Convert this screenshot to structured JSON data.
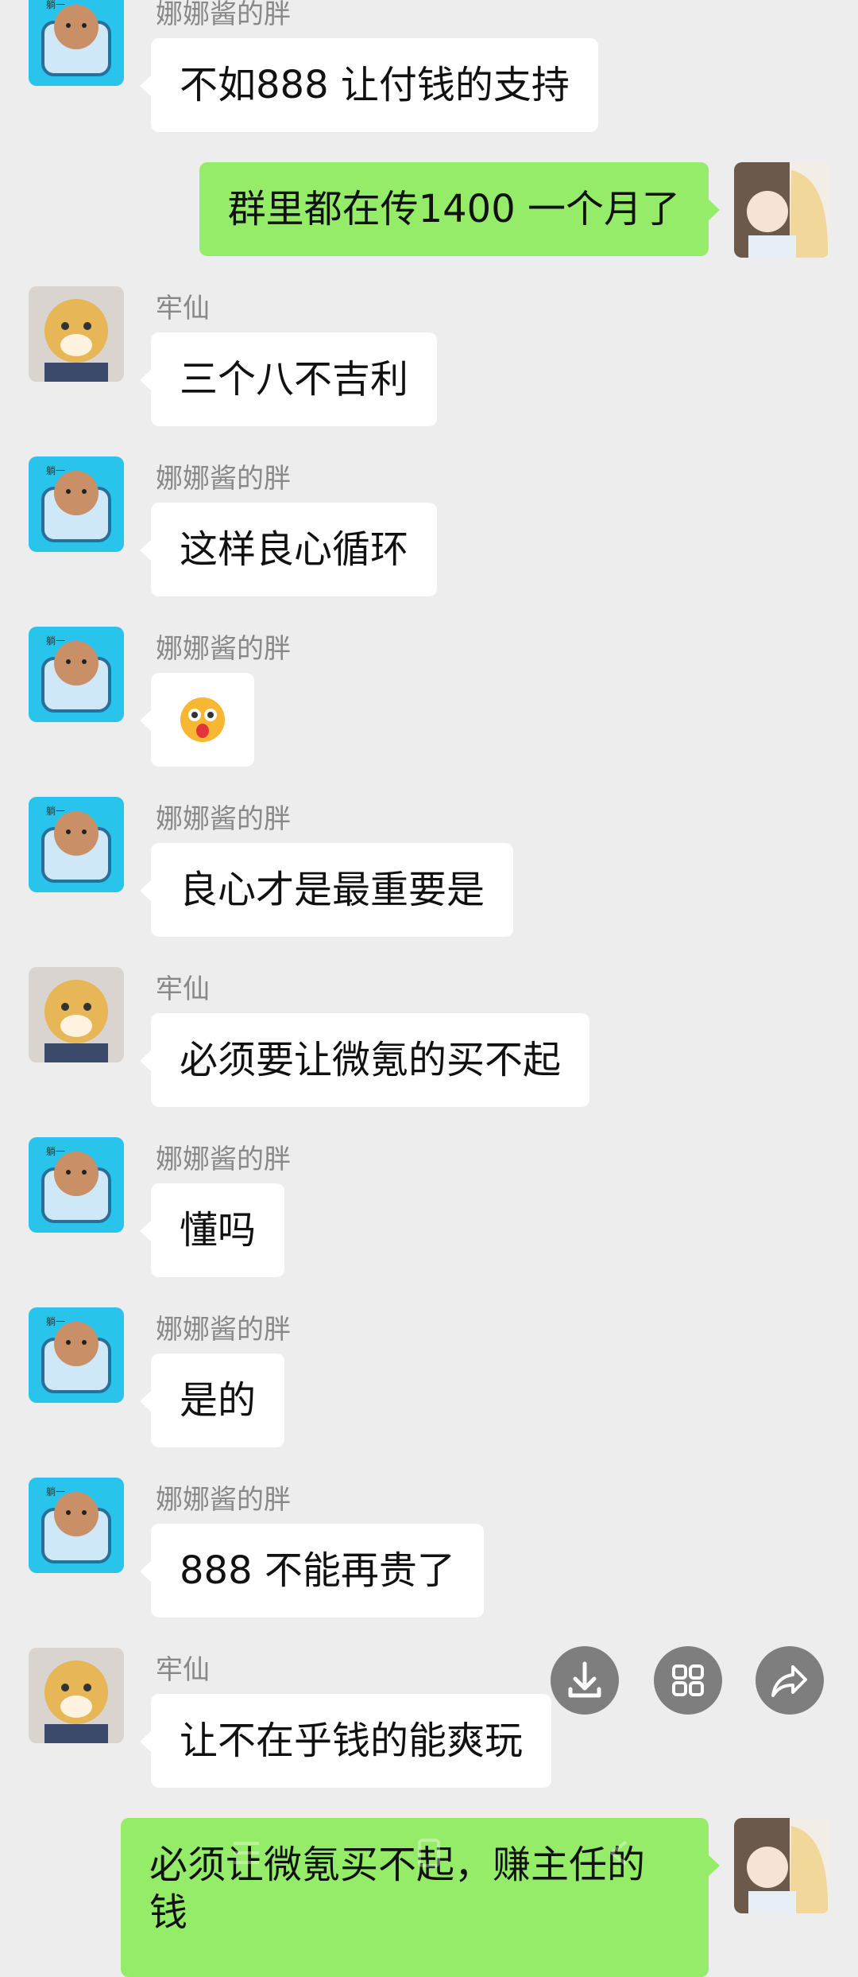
{
  "colors": {
    "background": "#ededed",
    "bubble_self": "#95ec69",
    "bubble_other": "#ffffff",
    "name_text": "#888888"
  },
  "messages": [
    {
      "sender": "娜娜酱的胖",
      "text": "不如888 让付钱的支持",
      "side": "left",
      "avatar": "bear-sofa-avatar"
    },
    {
      "sender": "",
      "text": "群里都在传1400 一个月了",
      "side": "right",
      "avatar": "anime-girl-avatar"
    },
    {
      "sender": "牢仙",
      "text": "三个八不吉利",
      "side": "left",
      "avatar": "cheetah-officer-avatar"
    },
    {
      "sender": "娜娜酱的胖",
      "text": "这样良心循环",
      "side": "left",
      "avatar": "bear-sofa-avatar"
    },
    {
      "sender": "娜娜酱的胖",
      "text": "",
      "emoji": "starry-eyed-tongue-emoji",
      "side": "left",
      "avatar": "bear-sofa-avatar"
    },
    {
      "sender": "娜娜酱的胖",
      "text": "良心才是最重要是",
      "side": "left",
      "avatar": "bear-sofa-avatar"
    },
    {
      "sender": "牢仙",
      "text": "必须要让微氪的买不起",
      "side": "left",
      "avatar": "cheetah-officer-avatar"
    },
    {
      "sender": "娜娜酱的胖",
      "text": "懂吗",
      "side": "left",
      "avatar": "bear-sofa-avatar"
    },
    {
      "sender": "娜娜酱的胖",
      "text": "是的",
      "side": "left",
      "avatar": "bear-sofa-avatar"
    },
    {
      "sender": "娜娜酱的胖",
      "text": "888 不能再贵了",
      "side": "left",
      "avatar": "bear-sofa-avatar"
    },
    {
      "sender": "牢仙",
      "text": "让不在乎钱的能爽玩",
      "side": "left",
      "avatar": "cheetah-officer-avatar"
    },
    {
      "sender": "",
      "text": "必须让微氪买不起，赚主任的",
      "text_line2": "钱",
      "side": "right",
      "avatar": "anime-girl-avatar"
    }
  ],
  "floating_actions": [
    {
      "icon": "download-icon"
    },
    {
      "icon": "grid-icon"
    },
    {
      "icon": "share-icon"
    }
  ]
}
